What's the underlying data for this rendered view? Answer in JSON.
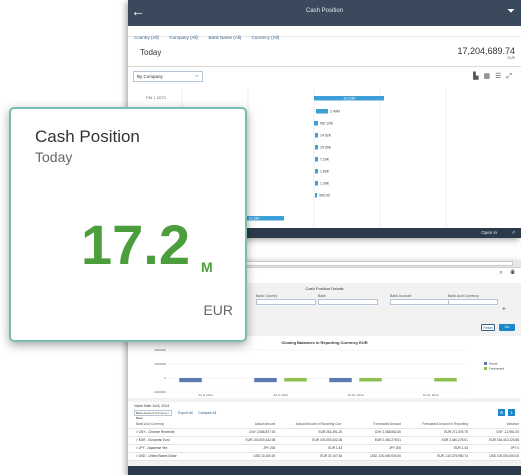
{
  "screen1": {
    "nav_back": "←",
    "title": "Cash Position",
    "filter_icon": "funnel-icon",
    "filters": [
      "Country (All)",
      "Company (All)",
      "Bank Name (All)",
      "Currency (All)"
    ],
    "today_label": "Today",
    "total_value": "17,204,689.74",
    "total_currency": "EUR",
    "group_select": "By Company",
    "row_label": "FIN 1 2072",
    "bar_labels": [
      "10.21M",
      "2.40M",
      "967.20K",
      "14.02K",
      "15.00K",
      "7.20K",
      "1.80K",
      "1.30K",
      "300.00",
      "13.19K"
    ],
    "footer_open_in": "Open in",
    "footer_share_icon": "share-icon"
  },
  "screen2": {
    "page_title": "Cash Position Details",
    "filter_labels": [
      "Bank Country",
      "Bank",
      "Bank Account",
      "Bank Acct Currency"
    ],
    "btn_reset": "Reset",
    "btn_go": "Go",
    "chart_title": "Closing Balances in Reporting Currency EUR",
    "legend": [
      "Actual",
      "Forecasted"
    ],
    "y_ticks": [
      "2000000",
      "1000000",
      "0",
      "-1000000"
    ],
    "x_ticks": [
      "Jul 8, 2014",
      "Jul 9, 2014",
      "Jul 10, 2014",
      "Jul 11, 2014"
    ],
    "table_caption": "Value Date Jul 8, 2014",
    "table_select": "Bank Account Currency / Bank",
    "export_link": "Export All",
    "collapse_link": "Collapse All",
    "columns": [
      "Bank Acct Currency",
      "Actual Amount",
      "Actual Amount in Reporting Curr.",
      "Forecasted Amount",
      "Forecasted Amount in Reporting",
      "Variance"
    ],
    "rows": [
      [
        "> CNY - Chinese Renminbi",
        "CNY 2,068,877.00",
        "EUR 261,491.20",
        "CNY 2,068,862.00",
        "EUR 271,375.75",
        "CNY -12,951.00"
      ],
      [
        "> EUR - European Euro",
        "EUR 100,000,442.08",
        "EUR 100,000,442.08",
        "EUR 2,460,278.01",
        "EUR 2,460,278.01",
        "EUR 164,410,220.85"
      ],
      [
        "> JPY - Japanese Yen",
        "JPY 200",
        "EUR 1.43",
        "JPY 200",
        "EUR 1.43",
        "JPY 0"
      ],
      [
        "> USD - United States Dollar",
        "USD 10,200.00",
        "EUR 37,107.64",
        "USD -100,000,000.00",
        "EUR -110,379,980.74",
        "USD 100,000,000.00"
      ]
    ]
  },
  "tile": {
    "title": "Cash Position",
    "subtitle": "Today",
    "value": "17.2",
    "scale": "M",
    "unit": "EUR"
  },
  "colors": {
    "tile_border": "#78bdb0",
    "kpi_green": "#4c9e3c",
    "shell": "#3a4a5c",
    "bar_blue": "#3d9fd8",
    "actual": "#5b7bb0",
    "forecast": "#8cc152"
  },
  "chart_data": {
    "type": "bar",
    "title": "Closing Balances in Reporting Currency EUR",
    "categories": [
      "Jul 8, 2014",
      "Jul 9, 2014",
      "Jul 10, 2014",
      "Jul 11, 2014"
    ],
    "series": [
      {
        "name": "Actual",
        "values": [
          -300000,
          -300000,
          -300000,
          0
        ]
      },
      {
        "name": "Forecasted",
        "values": [
          0,
          -250000,
          -250000,
          -250000
        ]
      }
    ],
    "ylim": [
      -1000000,
      2000000
    ],
    "legend_position": "top-right"
  }
}
